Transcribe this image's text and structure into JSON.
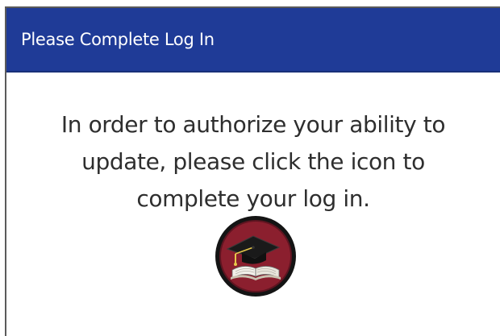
{
  "dialog": {
    "title": "Please Complete Log In",
    "message_lines": [
      "In order to authorize your ability to",
      "update, please click the icon to",
      "complete your log in."
    ]
  },
  "icon": {
    "name": "graduation-cap-book-icon",
    "ring_color": "#141414",
    "fill_color": "#8b1f2e"
  },
  "colors": {
    "titlebar": "#1f3b97",
    "title_text": "#ffffff",
    "body_text": "#2e2e2e"
  }
}
